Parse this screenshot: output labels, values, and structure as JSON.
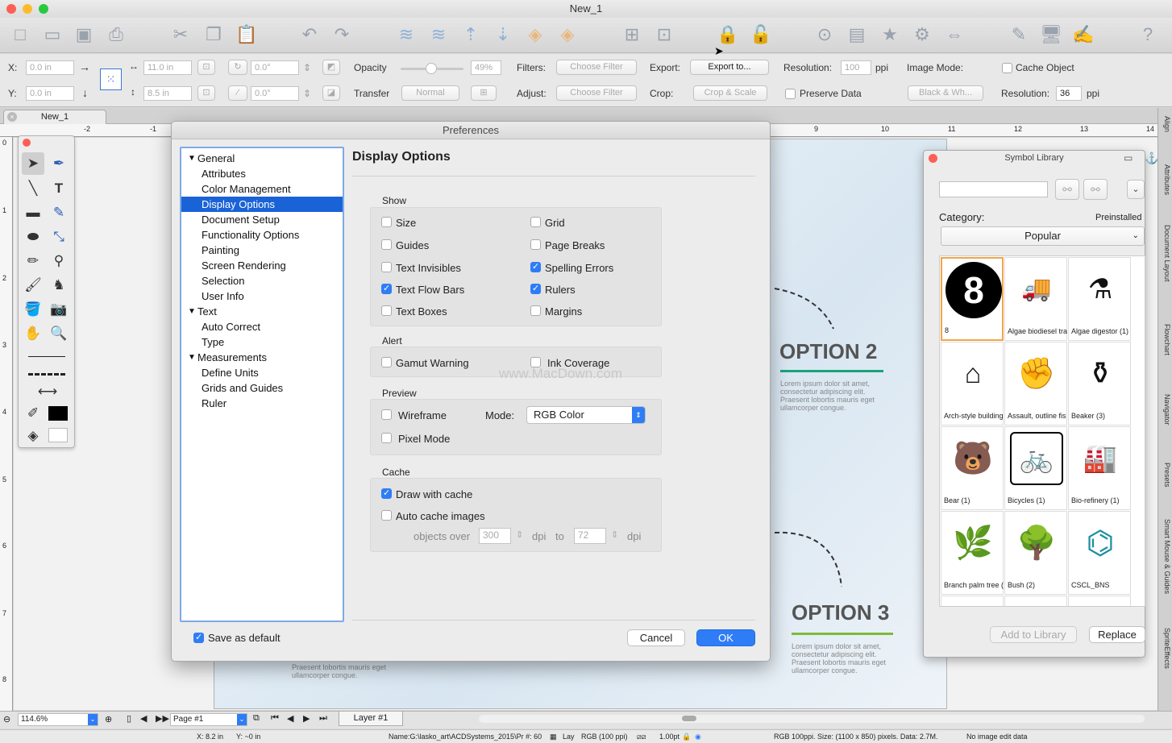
{
  "window": {
    "title": "New_1"
  },
  "props": {
    "x_label": "X:",
    "x_value": "0.0 in",
    "y_label": "Y:",
    "y_value": "0.0 in",
    "width_value": "11.0 in",
    "height_value": "8.5 in",
    "rotation_value": "0.0°",
    "skew_value": "0.0°",
    "opacity_label": "Opacity",
    "opacity_value": "49%",
    "transfer_label": "Transfer",
    "transfer_value": "Normal",
    "filters_label": "Filters:",
    "filters_value": "Choose Filter",
    "adjust_label": "Adjust:",
    "adjust_value": "Choose Filter",
    "export_label": "Export:",
    "export_value": "Export to...",
    "crop_label": "Crop:",
    "crop_value": "Crop & Scale",
    "resolution_label": "Resolution:",
    "resolution_value": "100",
    "ppi": "ppi",
    "preserve_data": "Preserve Data",
    "image_mode_label": "Image Mode:",
    "image_mode_value": "Black & Wh...",
    "cache_object": "Cache Object",
    "resolution2_label": "Resolution:",
    "resolution2_value": "36",
    "ppi2": "ppi"
  },
  "doc_tab": {
    "label": "New_1"
  },
  "ruler": {
    "top_marks": [
      "-2",
      "-1",
      "9",
      "10",
      "11",
      "12",
      "13",
      "14"
    ],
    "left_marks": [
      "0",
      "1",
      "2",
      "3",
      "4",
      "5",
      "6",
      "7",
      "8"
    ]
  },
  "canvas": {
    "option2_title": "OPTION 2",
    "option3_title": "OPTION 3",
    "lorem": "Lorem ipsum dolor sit amet, consectetur adipiscing elit. Praesent lobortis mauris eget ullamcorper congue.",
    "lorem_fragment": "Praesent lobortis mauris eget ullamcorper congue.",
    "accent_green": "#1aa37a"
  },
  "dialog": {
    "title": "Preferences",
    "heading": "Display Options",
    "tree": [
      {
        "label": "General",
        "level": 0,
        "expanded": true
      },
      {
        "label": "Attributes",
        "level": 1
      },
      {
        "label": "Color Management",
        "level": 1
      },
      {
        "label": "Display Options",
        "level": 1,
        "selected": true
      },
      {
        "label": "Document Setup",
        "level": 1
      },
      {
        "label": "Functionality Options",
        "level": 1
      },
      {
        "label": "Painting",
        "level": 1
      },
      {
        "label": "Screen Rendering",
        "level": 1
      },
      {
        "label": "Selection",
        "level": 1
      },
      {
        "label": "User Info",
        "level": 1
      },
      {
        "label": "Text",
        "level": 0,
        "expanded": true
      },
      {
        "label": "Auto Correct",
        "level": 1
      },
      {
        "label": "Type",
        "level": 1
      },
      {
        "label": "Measurements",
        "level": 0,
        "expanded": true
      },
      {
        "label": "Define Units",
        "level": 1
      },
      {
        "label": "Grids and Guides",
        "level": 1
      },
      {
        "label": "Ruler",
        "level": 1
      }
    ],
    "show_header": "Show",
    "show": {
      "size": {
        "label": "Size",
        "checked": false
      },
      "grid": {
        "label": "Grid",
        "checked": false
      },
      "guides": {
        "label": "Guides",
        "checked": false
      },
      "page_breaks": {
        "label": "Page Breaks",
        "checked": false
      },
      "text_invisibles": {
        "label": "Text Invisibles",
        "checked": false
      },
      "spelling_errors": {
        "label": "Spelling Errors",
        "checked": true
      },
      "text_flow_bars": {
        "label": "Text Flow Bars",
        "checked": true
      },
      "rulers": {
        "label": "Rulers",
        "checked": true
      },
      "text_boxes": {
        "label": "Text Boxes",
        "checked": false
      },
      "margins": {
        "label": "Margins",
        "checked": false
      }
    },
    "alert_header": "Alert",
    "gamut_warning": "Gamut Warning",
    "ink_coverage": "Ink Coverage",
    "preview_header": "Preview",
    "wireframe": "Wireframe",
    "mode_label": "Mode:",
    "mode_value": "RGB Color",
    "pixel_mode": "Pixel Mode",
    "cache_header": "Cache",
    "draw_with_cache": "Draw with cache",
    "auto_cache_images": "Auto cache images",
    "objects_over": "objects over",
    "dpi_low": "300",
    "dpi": "dpi",
    "to": "to",
    "dpi_high": "72",
    "save_as_default": "Save as default",
    "cancel": "Cancel",
    "ok": "OK"
  },
  "watermark": "www.MacDown.com",
  "symbol_library": {
    "title": "Symbol Library",
    "category_label": "Category:",
    "preinstalled": "Preinstalled",
    "category_value": "Popular",
    "items": [
      "8",
      "Algae biodiesel tra",
      "Algae digestor (1)",
      "Arch-style building",
      "Assault, outline fis",
      "Beaker (3)",
      "Bear (1)",
      "Bicycles (1)",
      "Bio-refinery (1)",
      "Branch palm tree (",
      "Bush (2)",
      "CSCL_BNS"
    ],
    "add_to_library": "Add to Library",
    "replace": "Replace"
  },
  "right_tabs": [
    "Align",
    "Attributes",
    "Document Layout",
    "Flowchart",
    "Navigator",
    "Presets",
    "Smart Mouse & Guides",
    "SpriteEffects"
  ],
  "bottom": {
    "zoom": "114.6%",
    "page": "Page #1",
    "layer": "Layer #1"
  },
  "status": {
    "x": "X: 8.2 in",
    "y": "Y: ~0 in",
    "name": "Name:G:\\lasko_art\\ACDSystems_2015\\Pr #: 60",
    "lay": "Lay",
    "rgb": "RGB (100 ppi)",
    "stroke": "1.00pt",
    "info": "RGB 100ppi. Size: (1100 x 850) pixels. Data:  2.7M.",
    "edit": "No image edit data"
  }
}
